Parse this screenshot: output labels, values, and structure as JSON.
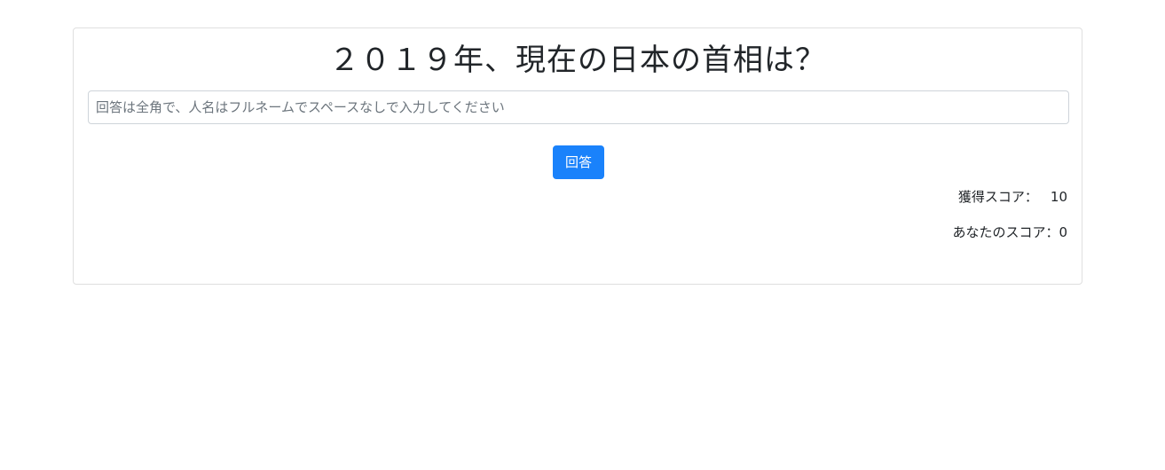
{
  "quiz": {
    "question": "２０１９年、現在の日本の首相は？",
    "answer_placeholder": "回答は全角で、人名はフルネームでスペースなしで入力してください",
    "answer_value": "",
    "submit_label": "回答",
    "earned_score_label": "獲得スコア：",
    "earned_score_value": "10",
    "your_score_label": "あなたのスコア：",
    "your_score_value": "0"
  },
  "colors": {
    "accent": "#1a82fb",
    "card_border": "#dfdfdf",
    "text": "#212529"
  }
}
